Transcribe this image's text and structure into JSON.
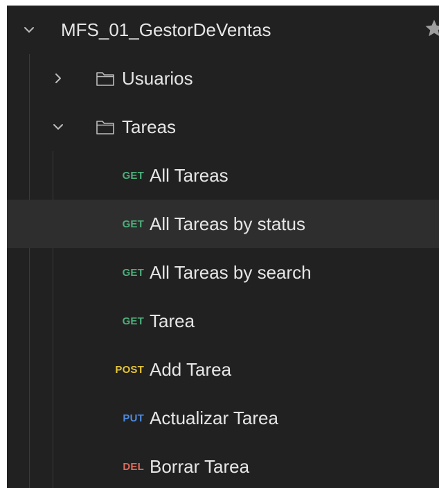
{
  "collection": {
    "name": "MFS_01_GestorDeVentas",
    "expanded": true,
    "star_icon": "star-icon"
  },
  "folders": [
    {
      "name": "Usuarios",
      "expanded": false
    },
    {
      "name": "Tareas",
      "expanded": true
    }
  ],
  "requests": [
    {
      "method": "GET",
      "name": "All Tareas",
      "method_color": "#4caf7a"
    },
    {
      "method": "GET",
      "name": "All Tareas by status",
      "method_color": "#4caf7a",
      "hovered": true
    },
    {
      "method": "GET",
      "name": "All Tareas by search",
      "method_color": "#4caf7a"
    },
    {
      "method": "GET",
      "name": "Tarea",
      "method_color": "#4caf7a"
    },
    {
      "method": "POST",
      "name": "Add Tarea",
      "method_color": "#e5c53a"
    },
    {
      "method": "PUT",
      "name": "Actualizar Tarea",
      "method_color": "#4d8be0"
    },
    {
      "method": "DEL",
      "name": "Borrar Tarea",
      "method_color": "#e06a5a"
    }
  ],
  "colors": {
    "background": "#212121",
    "hover_row": "#2e2e2e",
    "text": "#e6e6e6",
    "icon": "#bdbdbd",
    "guide": "#3a3a3a"
  }
}
